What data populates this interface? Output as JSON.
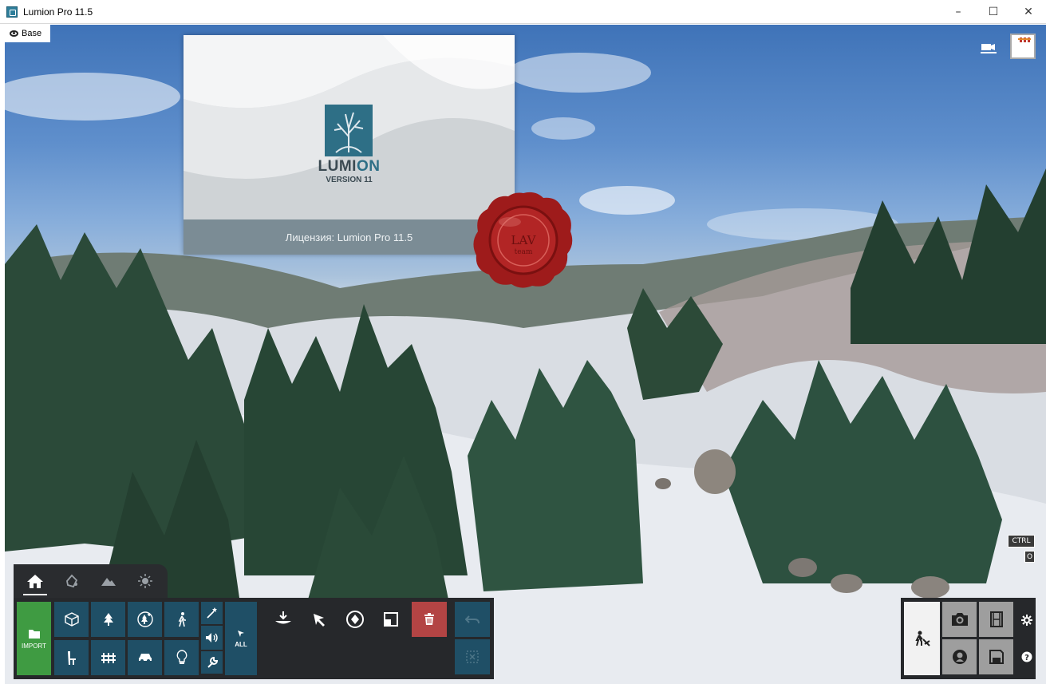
{
  "window": {
    "title": "Lumion Pro 11.5",
    "minimize": "–",
    "maximize": "☐",
    "close": "✕"
  },
  "layer": {
    "label": "Base"
  },
  "splash": {
    "logo_prefix": "LUMI",
    "logo_suffix": "ON",
    "version": "VERSION 11",
    "license": "Лицензия: Lumion Pro 11.5"
  },
  "seal": {
    "text": "LAV team"
  },
  "hotkeys": {
    "ctrl": "CTRL",
    "o": "O"
  },
  "toolbar": {
    "import_label": "IMPORT",
    "all_label": "ALL"
  },
  "colors": {
    "accent_green": "#3f9b42",
    "tile_blue": "#1f4f66",
    "delete_red": "#b34444",
    "panel_dark": "#26282b"
  }
}
